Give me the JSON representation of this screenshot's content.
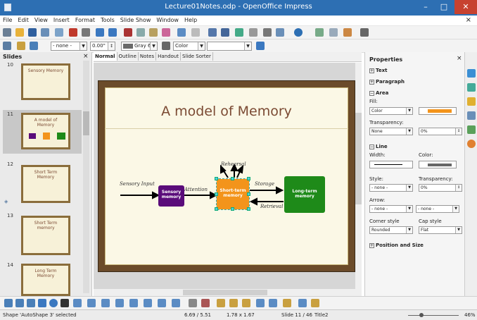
{
  "window": {
    "title": "Lecture01Notes.odp - OpenOffice Impress",
    "minimize": "–",
    "maximize": "□",
    "close": "✕"
  },
  "menu": [
    "File",
    "Edit",
    "View",
    "Insert",
    "Format",
    "Tools",
    "Slide Show",
    "Window",
    "Help"
  ],
  "menu_close": "×",
  "toolbar2": {
    "line_style": "- none -",
    "line_width": "0.00\"",
    "area_color": "Gray 6",
    "area_style": "Color"
  },
  "slides_panel": {
    "title": "Slides",
    "close": "×",
    "thumbnails": [
      {
        "num": "10",
        "title": "Sensory Memory"
      },
      {
        "num": "11",
        "title": "A model of Memory"
      },
      {
        "num": "12",
        "title": "Short Term Memory"
      },
      {
        "num": "13",
        "title": "Short Term memory"
      },
      {
        "num": "14",
        "title": "Long Term Memory"
      }
    ]
  },
  "view_tabs": [
    "Normal",
    "Outline",
    "Notes",
    "Handout",
    "Slide Sorter"
  ],
  "slide": {
    "title": "A model of Memory",
    "sensory_input": "Sensory Input",
    "attention": "Attention",
    "rehearsal": "Rehearsal",
    "storage": "Storage",
    "retrieval": "Retrieval",
    "box_sensory": "Sensory\nmemory",
    "box_short": "Short-term\nmemory",
    "box_long": "Long-term\nmemory",
    "colors": {
      "sensory": "#5a0c7a",
      "short": "#f3941b",
      "long": "#1e8a19",
      "title": "#7b4a33"
    }
  },
  "properties": {
    "title": "Properties",
    "close": "×",
    "sections": {
      "text": "Text",
      "paragraph": "Paragraph",
      "area": "Area",
      "line": "Line",
      "position": "Position and Size"
    },
    "fill_label": "Fill:",
    "fill_value": "Color",
    "transparency_label": "Transparency:",
    "transparency_value": "None",
    "transparency_percent": "0%",
    "width_label": "Width:",
    "color_label": "Color:",
    "style_label": "Style:",
    "style_value": "- none -",
    "line_transparency_label": "Transparency:",
    "line_transparency_value": "0%",
    "arrow_label": "Arrow:",
    "arrow_left": "- none -",
    "arrow_right": "- none -",
    "corner_label": "Corner style",
    "corner_value": "Rounded",
    "cap_label": "Cap style",
    "cap_value": "Flat"
  },
  "status": {
    "shape": "Shape 'AutoShape 3' selected",
    "position": "6.69 / 5.51",
    "size": "1.78 x 1.67",
    "slide": "Slide 11 / 46",
    "layout": "Title2",
    "zoom": "46%"
  }
}
